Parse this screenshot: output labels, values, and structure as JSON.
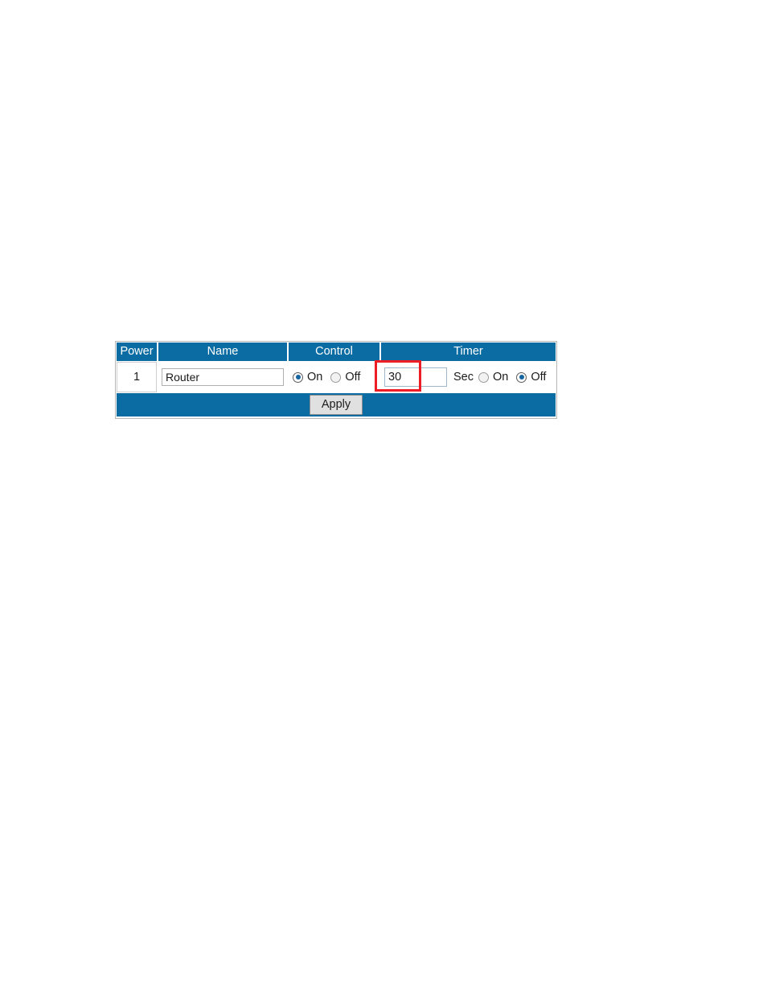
{
  "panel": {
    "columns": [
      {
        "key": "power",
        "label": "Power"
      },
      {
        "key": "name",
        "label": "Name"
      },
      {
        "key": "control",
        "label": "Control"
      },
      {
        "key": "timer",
        "label": "Timer"
      }
    ],
    "row": {
      "power_index": "1",
      "name_value": "Router",
      "name_placeholder": "",
      "control": {
        "on_label": "On",
        "off_label": "Off",
        "selected": "On"
      },
      "timer": {
        "seconds_value": "30",
        "seconds_placeholder": "",
        "unit_label": "Sec",
        "on_label": "On",
        "off_label": "Off",
        "selected": "Off"
      }
    },
    "apply_label": "Apply"
  },
  "annotation": {
    "target": "timer-seconds-input",
    "color": "#ee1c25"
  },
  "colors": {
    "header_blue": "#0b6ca3",
    "header_text": "#ffffff",
    "body_text": "#1b1b1b",
    "radio_fill": "#1765a0",
    "highlight_red": "#ee1c25",
    "button_face": "#e0e0e0",
    "panel_border": "#b6b6b6"
  }
}
